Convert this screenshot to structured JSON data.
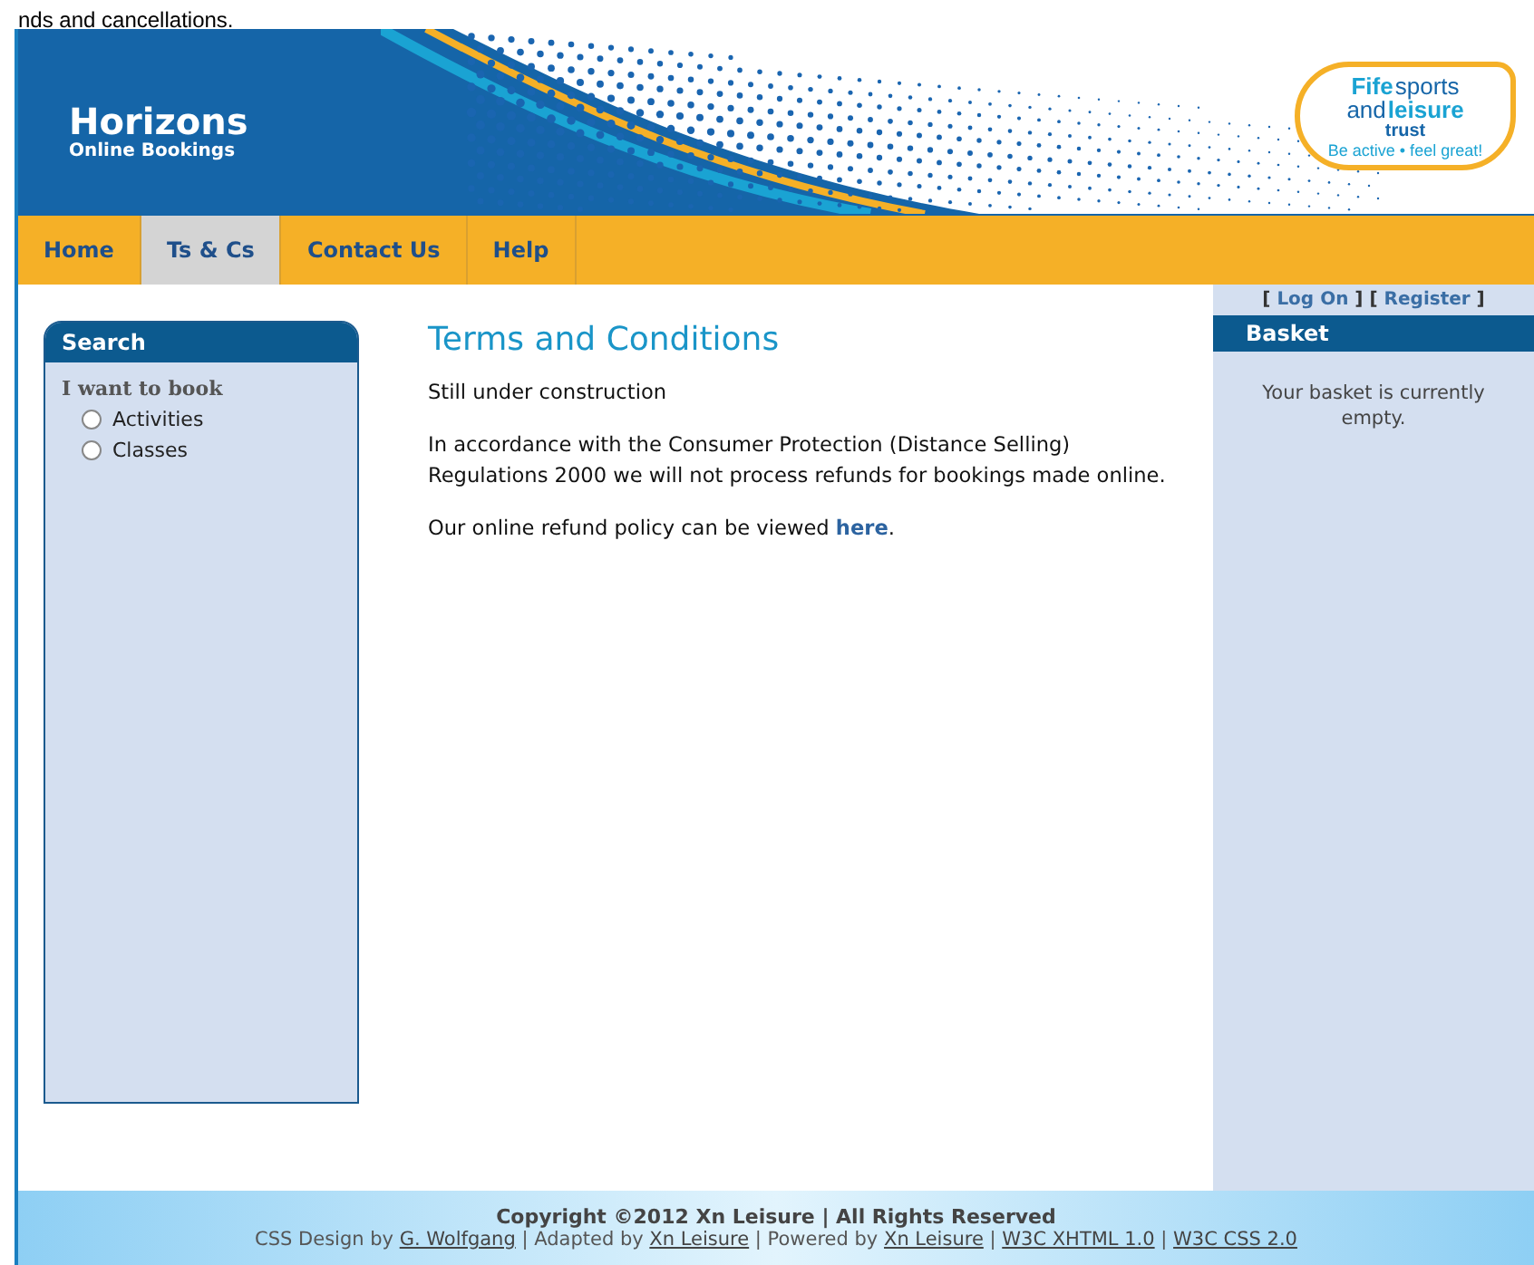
{
  "top_text": "nds and cancellations.",
  "header": {
    "title": "Horizons",
    "subtitle": "Online Bookings",
    "logo": {
      "line1_bold": "Fife",
      "line1": "sports",
      "line2": "and",
      "line2_bold": "leisure",
      "line3": "trust",
      "tagline": "Be active • feel great!"
    }
  },
  "tabs": [
    {
      "label": "Home",
      "selected": false
    },
    {
      "label": "Ts & Cs",
      "selected": true
    },
    {
      "label": "Contact Us",
      "selected": false
    },
    {
      "label": "Help",
      "selected": false
    }
  ],
  "search": {
    "title": "Search",
    "prompt": "I want to book",
    "options": [
      {
        "label": "Activities",
        "selected": false
      },
      {
        "label": "Classes",
        "selected": false
      }
    ]
  },
  "content": {
    "heading": "Terms and Conditions",
    "paragraphs": [
      [
        {
          "kind": "text",
          "text": "Still under construction"
        }
      ],
      [
        {
          "kind": "text",
          "text": "In accordance with the Consumer Protection (Distance Selling) Regulations 2000 we will not process refunds for bookings made online."
        }
      ],
      [
        {
          "kind": "text",
          "text": "Our online refund policy can be viewed "
        },
        {
          "kind": "link",
          "text": "here"
        },
        {
          "kind": "text",
          "text": "."
        }
      ]
    ]
  },
  "account_links": [
    {
      "kind": "text",
      "text": "[ "
    },
    {
      "kind": "link",
      "text": "Log On"
    },
    {
      "kind": "text",
      "text": " ] [ "
    },
    {
      "kind": "link",
      "text": "Register"
    },
    {
      "kind": "text",
      "text": " ]"
    }
  ],
  "basket": {
    "title": "Basket",
    "message": "Your basket is currently empty."
  },
  "footer": {
    "copyright": "Copyright ©2012 Xn Leisure | All Rights Reserved",
    "credits": [
      {
        "kind": "text",
        "text": "CSS Design by "
      },
      {
        "kind": "link",
        "text": "G. Wolfgang"
      },
      {
        "kind": "text",
        "text": " | Adapted by "
      },
      {
        "kind": "link",
        "text": "Xn Leisure"
      },
      {
        "kind": "text",
        "text": " | Powered by "
      },
      {
        "kind": "link",
        "text": "Xn Leisure"
      },
      {
        "kind": "text",
        "text": " | "
      },
      {
        "kind": "link",
        "text": "W3C XHTML 1.0"
      },
      {
        "kind": "text",
        "text": " | "
      },
      {
        "kind": "link",
        "text": "W3C CSS 2.0"
      }
    ]
  }
}
